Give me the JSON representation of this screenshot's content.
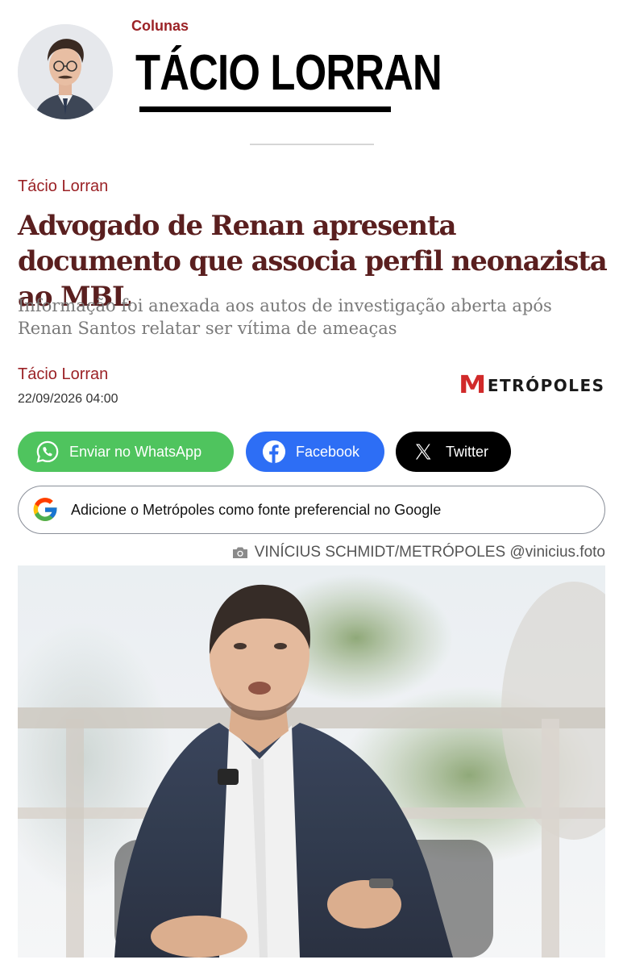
{
  "column": {
    "label": "Colunas",
    "name": "TÁCIO LORRAN"
  },
  "article": {
    "kicker": "Tácio Lorran",
    "headline": "Advogado de Renan apresenta documento que associa perfil neonazista ao MBL",
    "subhead": "Informação foi anexada aos autos de investigação aberta após Renan Santos relatar ser vítima de ameaças",
    "author": "Tácio Lorran",
    "date": "22/09/2026 04:00"
  },
  "brand": {
    "logo_mark": "M",
    "logo_text": "ETRÓPOLES",
    "accent_color": "#d12a2a"
  },
  "share": {
    "whatsapp_label": "Enviar no WhatsApp",
    "facebook_label": "Facebook",
    "twitter_label": "Twitter"
  },
  "google_prompt": "Adicione o Metrópoles como fonte preferencial no Google",
  "photo": {
    "credit": "VINÍCIUS SCHMIDT/METRÓPOLES @vinicius.foto",
    "icon": "camera-icon"
  },
  "colors": {
    "column_red": "#9b2226",
    "headline": "#5a1f1f",
    "whatsapp": "#4fc45e",
    "facebook": "#2d6ef5",
    "twitter": "#000000"
  }
}
